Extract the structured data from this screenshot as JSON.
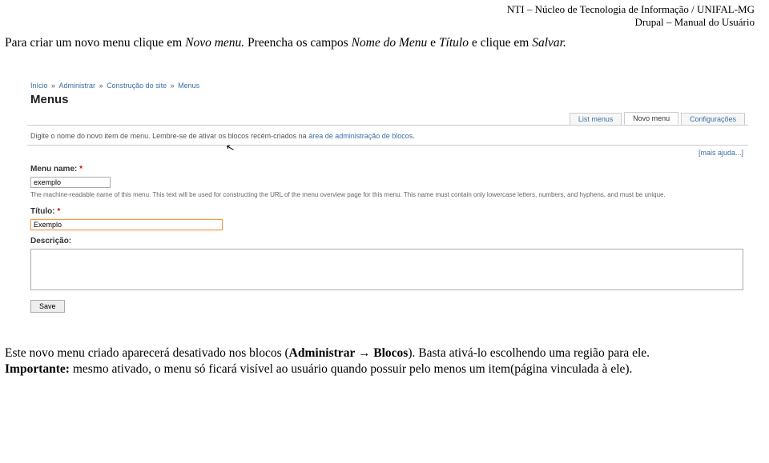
{
  "header": {
    "line1": "NTI – Núcleo de Tecnologia de Informação / UNIFAL-MG",
    "line2": "Drupal – Manual do Usuário"
  },
  "intro": {
    "p1a": "Para criar um novo menu clique em ",
    "p1b": "Novo menu.",
    "p1c": " Preencha os campos ",
    "p1d": "Nome do Menu",
    "p1e": " e ",
    "p1f": "Título",
    "p1g": " e clique em ",
    "p1h": "Salvar.",
    "p1i": ""
  },
  "screenshot": {
    "breadcrumb": {
      "b1": "Início",
      "b2": "Administrar",
      "b3": "Construção do site",
      "b4": "Menus"
    },
    "title": "Menus",
    "tabs": {
      "list": "List menus",
      "novo": "Novo menu",
      "config": "Configurações"
    },
    "intro_a": "Digite o nome do novo item de menu. Lembre-se de ativar os blocos recém-criados na ",
    "intro_link": "área de administração de blocos",
    "intro_b": ".",
    "help": "[mais ajuda...]",
    "menu_name_label": "Menu name:",
    "menu_name_value": "exemplo",
    "menu_name_desc": "The machine-readable name of this menu. This text will be used for constructing the URL of the menu overview page for this menu. This name must contain only lowercase letters, numbers, and hyphens, and must be unique.",
    "titulo_label": "Título:",
    "titulo_value": "Exemplo",
    "descricao_label": "Descrição:",
    "save_label": "Save"
  },
  "bottom": {
    "p2a": "Este novo menu criado aparecerá desativado nos blocos (",
    "p2b": "Administrar → Blocos",
    "p2c": "). Basta ativá-lo escolhendo uma região para ele.",
    "p3a": "Importante:",
    "p3b": " mesmo ativado, o menu só ficará visível ao usuário quando possuir pelo menos um item(página vinculada à ele)."
  }
}
